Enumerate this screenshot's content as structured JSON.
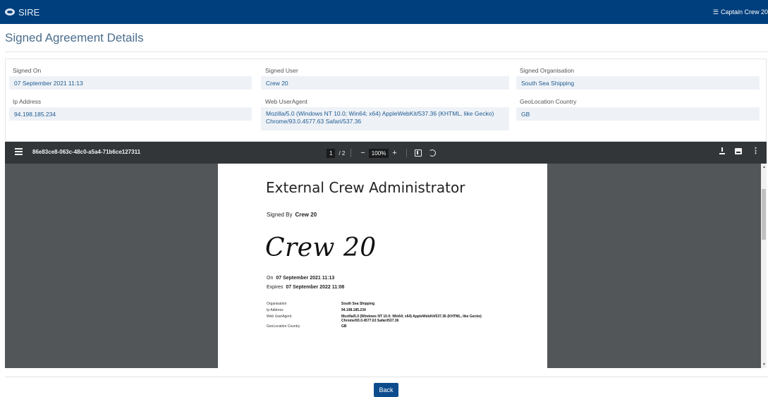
{
  "app": {
    "name": "SIRE",
    "logo_icon": "sire-logo-icon"
  },
  "user_menu": {
    "icon": "hamburger-icon",
    "label": "Captain Crew 20"
  },
  "page": {
    "title": "Signed Agreement Details"
  },
  "details": {
    "signed_on": {
      "label": "Signed On",
      "value": "07 September 2021 11:13"
    },
    "signed_user": {
      "label": "Signed User",
      "value": "Crew 20"
    },
    "signed_organisation": {
      "label": "Signed Organisation",
      "value": "South Sea Shipping"
    },
    "ip_address": {
      "label": "Ip Address",
      "value": "94.198.185.234"
    },
    "web_useragent": {
      "label": "Web UserAgent",
      "value_line1": "Mozilla/5.0 (Windows NT 10.0; Win64; x64) AppleWebKit/537.36 (KHTML, like Gecko)",
      "value_line2": "Chrome/93.0.4577.63 Safari/537.36"
    },
    "geolocation_country": {
      "label": "GeoLocation Country",
      "value": "GB"
    }
  },
  "pdf_viewer": {
    "filename": "86e83ce8-063c-48c0-a5a4-71b6ce127311",
    "current_page": "1",
    "total_pages": "/ 2",
    "zoom_out": "−",
    "zoom": "100%",
    "zoom_in": "+",
    "toolbar_icons": [
      "menu-icon",
      "fit-page-icon",
      "rotate-icon",
      "download-icon",
      "print-icon",
      "more-options-icon"
    ],
    "more_glyph": "⋮",
    "document": {
      "heading": "External Crew Administrator",
      "signed_by_label": "Signed By",
      "signed_by_value": "Crew 20",
      "signature": "Crew 20",
      "on_label": "On",
      "on_value": "07 September 2021 11:13",
      "expires_label": "Expires",
      "expires_value": "07 September 2022 11:08",
      "rows": [
        {
          "key": "Organisation",
          "value": "South Sea Shipping"
        },
        {
          "key": "Ip Address",
          "value": "94.198.185.234"
        },
        {
          "key": "Web UserAgent",
          "value": "Mozilla/5.0 (Windows NT 10.0; Win64; x64) AppleWebKit/537.36 (KHTML, like Gecko) Chrome/93.0.4577.63 Safari/537.36"
        },
        {
          "key": "GeoLocation Country",
          "value": "GB"
        }
      ]
    }
  },
  "actions": {
    "back_label": "Back"
  }
}
